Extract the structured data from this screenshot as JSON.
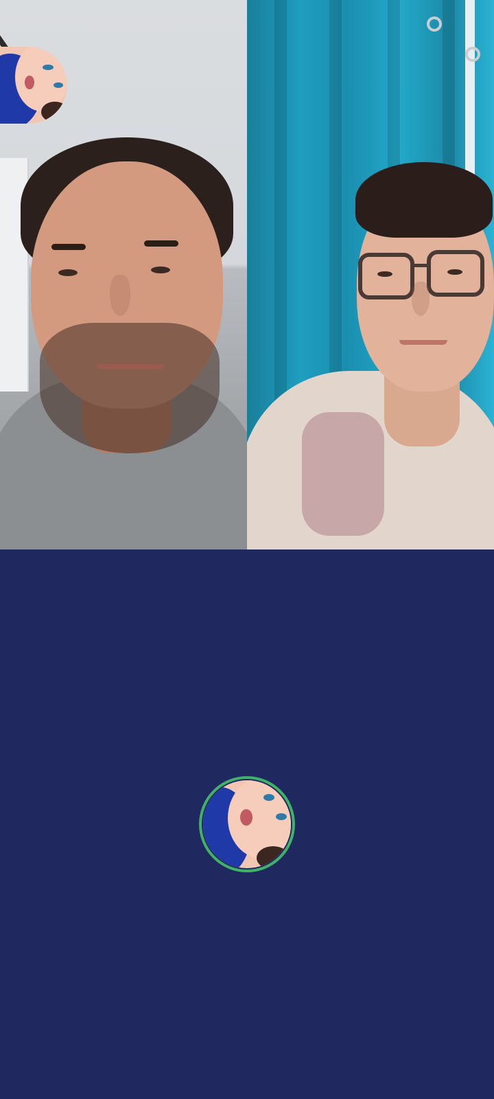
{
  "call": {
    "state": "group-video-call",
    "participants": [
      {
        "tile": "left",
        "camera": "on"
      },
      {
        "tile": "right",
        "camera": "on"
      }
    ],
    "self_preview": {
      "shape": "circle",
      "position": "top-left"
    },
    "active_speaker": {
      "camera": "off",
      "speaking_indicator_color": "#3fb26a"
    }
  },
  "colors": {
    "background": "#1f285f",
    "speaking_ring": "#3fb26a"
  }
}
